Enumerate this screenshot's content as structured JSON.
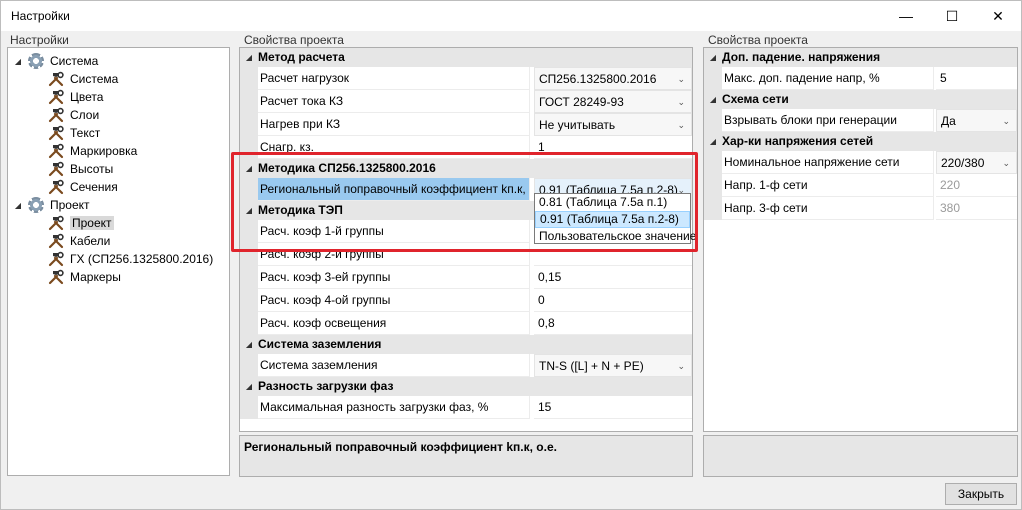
{
  "window": {
    "title": "Настройки",
    "minimize_glyph": "—",
    "maximize_glyph": "☐",
    "close_glyph": "✕"
  },
  "left": {
    "group_label": "Настройки",
    "tree": [
      {
        "label": "Система",
        "level": 0,
        "icon": "gear-icon",
        "expanded": true
      },
      {
        "label": "Система",
        "level": 1,
        "icon": "tools-icon"
      },
      {
        "label": "Цвета",
        "level": 1,
        "icon": "tools-icon"
      },
      {
        "label": "Слои",
        "level": 1,
        "icon": "tools-icon"
      },
      {
        "label": "Текст",
        "level": 1,
        "icon": "tools-icon"
      },
      {
        "label": "Маркировка",
        "level": 1,
        "icon": "tools-icon"
      },
      {
        "label": "Высоты",
        "level": 1,
        "icon": "tools-icon"
      },
      {
        "label": "Сечения",
        "level": 1,
        "icon": "tools-icon"
      },
      {
        "label": "Проект",
        "level": 0,
        "icon": "gear-icon",
        "expanded": true
      },
      {
        "label": "Проект",
        "level": 1,
        "icon": "tools-icon",
        "selected": true
      },
      {
        "label": "Кабели",
        "level": 1,
        "icon": "tools-icon"
      },
      {
        "label": "ГХ (СП256.1325800.2016)",
        "level": 1,
        "icon": "tools-icon"
      },
      {
        "label": "Маркеры",
        "level": 1,
        "icon": "tools-icon"
      }
    ]
  },
  "middle": {
    "group_label": "Свойства проекта",
    "categories": [
      {
        "title": "Метод расчета",
        "rows": [
          {
            "name": "Расчет нагрузок",
            "value": "СП256.1325800.2016",
            "combo": true
          },
          {
            "name": "Расчет тока КЗ",
            "value": "ГОСТ 28249-93",
            "combo": true
          },
          {
            "name": "Нагрев при КЗ",
            "value": "Не учитывать",
            "combo": true
          },
          {
            "name": "Снагр. кз.",
            "value": "1"
          }
        ]
      },
      {
        "title": "Методика СП256.1325800.2016",
        "rows": [
          {
            "name": "Региональный поправочный коэффициент kп.к, о.е.",
            "value": "0.91 (Таблица 7.5а п.2-8)",
            "combo": true,
            "selected": true
          }
        ]
      },
      {
        "title": "Методика ТЭП",
        "rows": [
          {
            "name": "Расч. коэф 1-й группы",
            "value": "0,"
          },
          {
            "name": "Расч. коэф 2-й группы",
            "value": ""
          },
          {
            "name": "Расч. коэф 3-ей группы",
            "value": "0,15"
          },
          {
            "name": "Расч. коэф 4-ой группы",
            "value": "0"
          },
          {
            "name": "Расч. коэф освещения",
            "value": "0,8"
          }
        ]
      },
      {
        "title": "Система заземления",
        "rows": [
          {
            "name": "Система заземления",
            "value": "TN-S ([L] + N + PE)",
            "combo": true
          }
        ]
      },
      {
        "title": "Разность загрузки фаз",
        "rows": [
          {
            "name": "Максимальная разность загрузки фаз, %",
            "value": "15"
          }
        ]
      }
    ],
    "dropdown_options": [
      "0.81 (Таблица 7.5а п.1)",
      "0.91 (Таблица 7.5а п.2-8)",
      "Пользовательское значение"
    ],
    "dropdown_highlighted": 1,
    "description": "Региональный поправочный коэффициент kп.к, о.е."
  },
  "right": {
    "group_label": "Свойства проекта",
    "categories": [
      {
        "title": "Доп. падение. напряжения",
        "rows": [
          {
            "name": "Макс. доп. падение напр, %",
            "value": "5"
          }
        ]
      },
      {
        "title": "Схема сети",
        "rows": [
          {
            "name": "Взрывать блоки при генерации",
            "value": "Да",
            "combo": true
          }
        ]
      },
      {
        "title": "Хар-ки напряжения сетей",
        "rows": [
          {
            "name": "Номинальное напряжение сети",
            "value": "220/380",
            "combo": true
          },
          {
            "name": "Напр. 1-ф сети",
            "value": "220",
            "disabled": true
          },
          {
            "name": "Напр. 3-ф сети",
            "value": "380",
            "disabled": true
          }
        ]
      }
    ]
  },
  "footer": {
    "close_button": "Закрыть"
  },
  "colors": {
    "highlight_box": "#e0242c",
    "selection": "#cce8ff",
    "category_bg": "#e6e6e6"
  }
}
